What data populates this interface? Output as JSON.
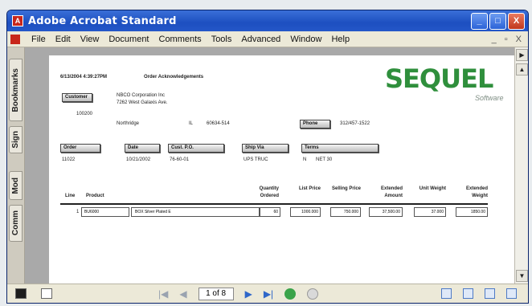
{
  "window": {
    "title": "Adobe Acrobat Standard",
    "app_icon": "acrobat-icon",
    "min_label": "_",
    "max_label": "□",
    "close_label": "X"
  },
  "menu": {
    "items": [
      "File",
      "Edit",
      "View",
      "Document",
      "Comments",
      "Tools",
      "Advanced",
      "Window",
      "Help"
    ],
    "doc_controls": [
      "_",
      "▫",
      "X"
    ]
  },
  "side_tabs": [
    "Bookmarks",
    "Sign",
    "Mod",
    "Comm"
  ],
  "document": {
    "date_line": "6/13/2004  4:39:27PM",
    "doc_title": "Order Acknowledgements",
    "logo_main": "SEQUEL",
    "logo_sub": "Software",
    "customer_label": "Customer",
    "customer_number": "100200",
    "customer_name": "NBCO Corporation Inc",
    "customer_address": "7262 West Galaxis Ave.",
    "customer_city": "Northridge",
    "customer_state": "IL",
    "customer_zip": "60634-514",
    "phone_label": "Phone",
    "phone_value": "312/457-1522",
    "order_label": "Order",
    "order_value": "11022",
    "date_label": "Date",
    "date_value": "10/21/2002",
    "custpo_label": "Cust. P.O.",
    "custpo_value": "76-60-01",
    "shipvia_label": "Ship Via",
    "shipvia_value": "UPS TRUC",
    "terms_label": "Terms",
    "terms_code": "N",
    "terms_value": "NET 30",
    "table": {
      "headers": [
        "Line",
        "Product",
        "Quantity Ordered",
        "List Price",
        "Selling Price",
        "Extended Amount",
        "Unit Weight",
        "Extended Weight"
      ],
      "row": {
        "line": "1",
        "product": "BU6000",
        "description": "BOX Silver Plated E",
        "qty": "60",
        "list": "1000.000",
        "sell": "750.000",
        "extended": "37,500.00",
        "unit_weight": "37.000",
        "ext_weight": "1850.00"
      }
    }
  },
  "status": {
    "page_display": "1 of 8"
  }
}
